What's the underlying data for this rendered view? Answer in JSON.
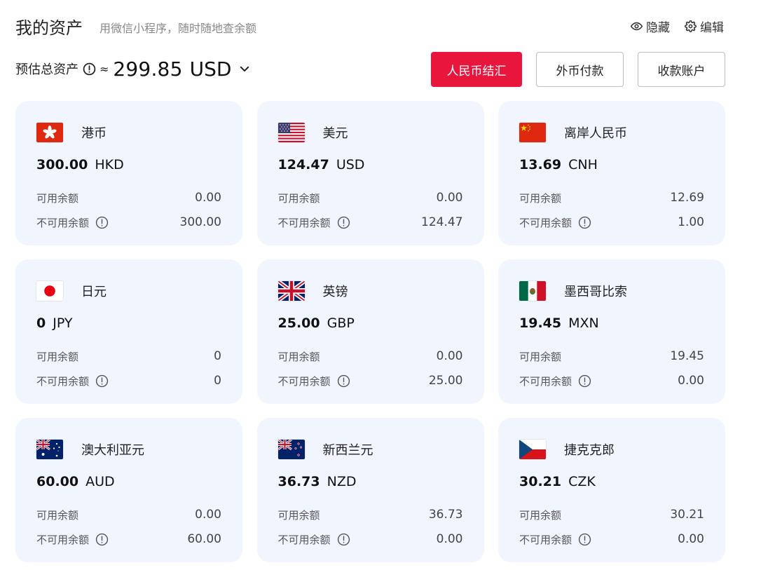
{
  "header": {
    "title": "我的资产",
    "subtitle": "用微信小程序，随时随地查余额",
    "hide_label": "隐藏",
    "edit_label": "编辑",
    "icons": {
      "hide": "eye-icon",
      "edit": "gear-icon"
    }
  },
  "total": {
    "label": "预估总资产",
    "approx": "≈",
    "amount": "299.85",
    "currency": "USD"
  },
  "buttons": {
    "rmb_exchange": "人民币结汇",
    "foreign_payment": "外币付款",
    "receiving_account": "收款账户"
  },
  "colors": {
    "primary": "#e8163d",
    "card_bg": "#f1f6fe"
  },
  "cards": [
    {
      "flag": "hk-flag-icon",
      "name": "港币",
      "amount": "300.00",
      "code": "HKD",
      "available_label": "可用余额",
      "available": "0.00",
      "unavailable_label": "不可用余额",
      "unavailable": "300.00"
    },
    {
      "flag": "us-flag-icon",
      "name": "美元",
      "amount": "124.47",
      "code": "USD",
      "available_label": "可用余额",
      "available": "0.00",
      "unavailable_label": "不可用余额",
      "unavailable": "124.47"
    },
    {
      "flag": "cn-flag-icon",
      "name": "离岸人民币",
      "amount": "13.69",
      "code": "CNH",
      "available_label": "可用余额",
      "available": "12.69",
      "unavailable_label": "不可用余额",
      "unavailable": "1.00"
    },
    {
      "flag": "jp-flag-icon",
      "name": "日元",
      "amount": "0",
      "code": "JPY",
      "available_label": "可用余额",
      "available": "0",
      "unavailable_label": "不可用余额",
      "unavailable": "0"
    },
    {
      "flag": "gb-flag-icon",
      "name": "英镑",
      "amount": "25.00",
      "code": "GBP",
      "available_label": "可用余额",
      "available": "0.00",
      "unavailable_label": "不可用余额",
      "unavailable": "25.00"
    },
    {
      "flag": "mx-flag-icon",
      "name": "墨西哥比索",
      "amount": "19.45",
      "code": "MXN",
      "available_label": "可用余额",
      "available": "19.45",
      "unavailable_label": "不可用余额",
      "unavailable": "0.00"
    },
    {
      "flag": "au-flag-icon",
      "name": "澳大利亚元",
      "amount": "60.00",
      "code": "AUD",
      "available_label": "可用余额",
      "available": "0.00",
      "unavailable_label": "不可用余额",
      "unavailable": "60.00"
    },
    {
      "flag": "nz-flag-icon",
      "name": "新西兰元",
      "amount": "36.73",
      "code": "NZD",
      "available_label": "可用余额",
      "available": "36.73",
      "unavailable_label": "不可用余额",
      "unavailable": "0.00"
    },
    {
      "flag": "cz-flag-icon",
      "name": "捷克克郎",
      "amount": "30.21",
      "code": "CZK",
      "available_label": "可用余额",
      "available": "30.21",
      "unavailable_label": "不可用余额",
      "unavailable": "0.00"
    }
  ]
}
